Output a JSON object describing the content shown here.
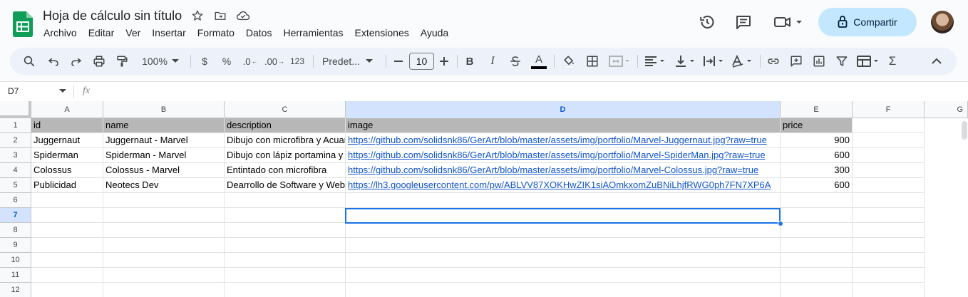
{
  "app": {
    "title": "Hoja de cálculo sin título",
    "menu": [
      "Archivo",
      "Editar",
      "Ver",
      "Insertar",
      "Formato",
      "Datos",
      "Herramientas",
      "Extensiones",
      "Ayuda"
    ],
    "share_label": "Compartir",
    "colors": {
      "accent": "#0b57d0",
      "share_bg": "#c2e7ff",
      "logo_green": "#0f9d58"
    }
  },
  "toolbar": {
    "zoom": "100%",
    "currency": "$",
    "percent": "%",
    "dec_decrease": ".0",
    "dec_increase": ".00",
    "format_123": "123",
    "font": "Predet...",
    "font_size": "10"
  },
  "formula_bar": {
    "cell_ref": "D7",
    "fx": "fx",
    "value": ""
  },
  "grid": {
    "columns": [
      "A",
      "B",
      "C",
      "D",
      "E",
      "F",
      "G"
    ],
    "selected_column": "D",
    "selected_row": "7",
    "row_numbers": [
      "1",
      "2",
      "3",
      "4",
      "5",
      "6",
      "7",
      "8",
      "9",
      "10",
      "11",
      "12"
    ],
    "rows": [
      [
        "id",
        "name",
        "description",
        "image",
        "price"
      ],
      [
        "Juggernaut",
        "Juggernaut - Marvel",
        "Dibujo con microfibra y Acuarela",
        "https://github.com/solidsnk86/GerArt/blob/master/assets/img/portfolio/Marvel-Juggernaut.jpg?raw=true",
        "900"
      ],
      [
        "Spiderman",
        "Spiderman - Marvel",
        "Dibujo con lápiz portamina y",
        "https://github.com/solidsnk86/GerArt/blob/master/assets/img/portfolio/Marvel-SpiderMan.jpg?raw=true",
        "600"
      ],
      [
        "Colossus",
        "Colossus - Marvel",
        "Entintado con microfibra",
        "https://github.com/solidsnk86/GerArt/blob/master/assets/img/portfolio/Marvel-Colossus.jpg?raw=true",
        "300"
      ],
      [
        "Publicidad",
        "Neotecs Dev",
        "Dearrollo de Software y Web",
        "https://lh3.googleusercontent.com/pw/ABLVV87XOKHwZIK1siAOmkxomZuBNiLhjfRWG0ph7FN7XP6A",
        "600"
      ]
    ]
  }
}
